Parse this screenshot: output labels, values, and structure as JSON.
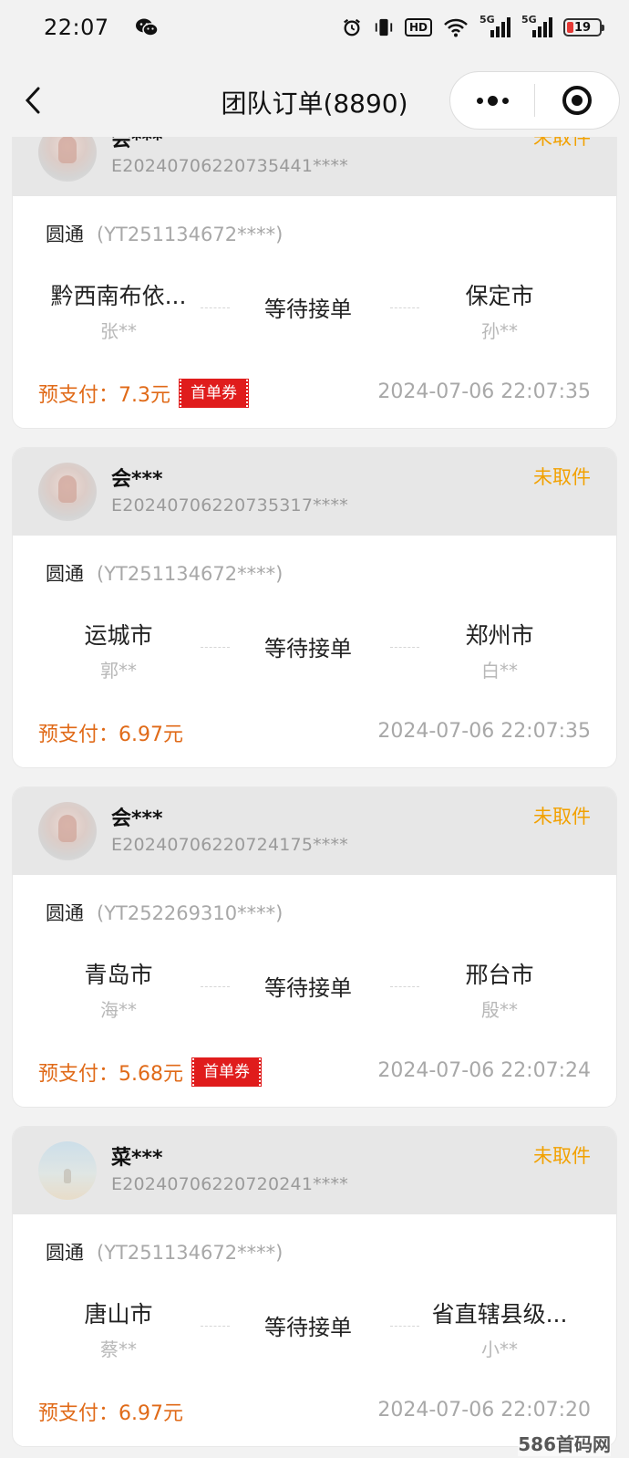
{
  "status_bar": {
    "time": "22:07",
    "hd_label": "HD",
    "signal1_label": "5G",
    "signal2_label": "5G",
    "battery_level": "19"
  },
  "nav": {
    "title": "团队订单(8890)"
  },
  "orders": [
    {
      "user": "会***",
      "order_no": "E20240706220735441****",
      "status": "未取件",
      "carrier": "圆通",
      "tracking": "(YT251134672****)",
      "from_city": "黔西南布依...",
      "from_person": "张**",
      "to_city": "保定市",
      "to_person": "孙**",
      "route_status": "等待接单",
      "prepay_label": "预支付：",
      "prepay_amount": "7.3元",
      "coupon": "首单券",
      "time": "2024-07-06 22:07:35"
    },
    {
      "user": "会***",
      "order_no": "E20240706220735317****",
      "status": "未取件",
      "carrier": "圆通",
      "tracking": "(YT251134672****)",
      "from_city": "运城市",
      "from_person": "郭**",
      "to_city": "郑州市",
      "to_person": "白**",
      "route_status": "等待接单",
      "prepay_label": "预支付：",
      "prepay_amount": "6.97元",
      "coupon": "",
      "time": "2024-07-06 22:07:35"
    },
    {
      "user": "会***",
      "order_no": "E20240706220724175****",
      "status": "未取件",
      "carrier": "圆通",
      "tracking": "(YT252269310****)",
      "from_city": "青岛市",
      "from_person": "海**",
      "to_city": "邢台市",
      "to_person": "殷**",
      "route_status": "等待接单",
      "prepay_label": "预支付：",
      "prepay_amount": "5.68元",
      "coupon": "首单券",
      "time": "2024-07-06 22:07:24"
    },
    {
      "user": "菜***",
      "order_no": "E20240706220720241****",
      "status": "未取件",
      "carrier": "圆通",
      "tracking": "(YT251134672****)",
      "from_city": "唐山市",
      "from_person": "蔡**",
      "to_city": "省直辖县级...",
      "to_person": "小**",
      "route_status": "等待接单",
      "prepay_label": "预支付：",
      "prepay_amount": "6.97元",
      "coupon": "",
      "time": "2024-07-06 22:07:20"
    }
  ],
  "watermark": "586首码网",
  "colors": {
    "status_orange": "#f2a100",
    "prepay_orange": "#e06a18",
    "coupon_red": "#e01c1c"
  }
}
